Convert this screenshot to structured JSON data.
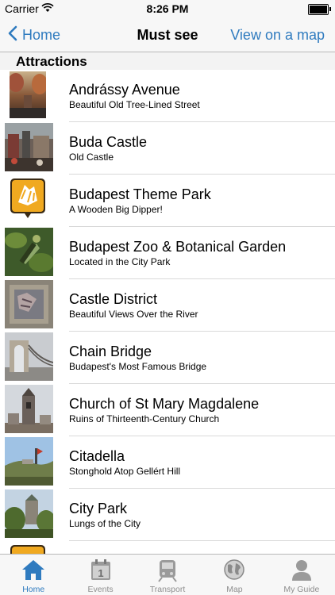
{
  "status_bar": {
    "carrier": "Carrier",
    "time": "8:26 PM"
  },
  "nav": {
    "back_label": "Home",
    "title": "Must see",
    "action_label": "View on a map"
  },
  "section": {
    "title": "Attractions"
  },
  "items": [
    {
      "title": "Andrássy Avenue",
      "subtitle": "Beautiful Old Tree-Lined Street",
      "icon": "andrassy-avenue-thumbnail"
    },
    {
      "title": "Buda Castle",
      "subtitle": "Old Castle",
      "icon": "buda-castle-thumbnail"
    },
    {
      "title": "Budapest Theme Park",
      "subtitle": "A Wooden Big Dipper!",
      "icon": "theme-park-icon"
    },
    {
      "title": "Budapest Zoo & Botanical Garden",
      "subtitle": "Located in the City Park",
      "icon": "zoo-thumbnail"
    },
    {
      "title": "Castle District",
      "subtitle": "Beautiful Views Over the River",
      "icon": "castle-district-thumbnail"
    },
    {
      "title": "Chain Bridge",
      "subtitle": "Budapest's Most Famous Bridge",
      "icon": "chain-bridge-thumbnail"
    },
    {
      "title": "Church of St Mary Magdalene",
      "subtitle": "Ruins of Thirteenth-Century Church",
      "icon": "church-thumbnail"
    },
    {
      "title": "Citadella",
      "subtitle": "Stonghold Atop Gellért Hill",
      "icon": "citadella-thumbnail"
    },
    {
      "title": "City Park",
      "subtitle": "Lungs of the City",
      "icon": "city-park-thumbnail"
    },
    {
      "title": "",
      "subtitle": "",
      "icon": "theme-park-icon"
    }
  ],
  "tabs": [
    {
      "label": "Home",
      "icon": "home-icon",
      "active": true
    },
    {
      "label": "Events",
      "icon": "calendar-icon",
      "active": false
    },
    {
      "label": "Transport",
      "icon": "train-icon",
      "active": false
    },
    {
      "label": "Map",
      "icon": "globe-icon",
      "active": false
    },
    {
      "label": "My Guide",
      "icon": "person-icon",
      "active": false
    }
  ],
  "colors": {
    "accent": "#2f7bbf",
    "tab_inactive": "#8e8e8e",
    "theme_icon_bg": "#f0a920"
  }
}
